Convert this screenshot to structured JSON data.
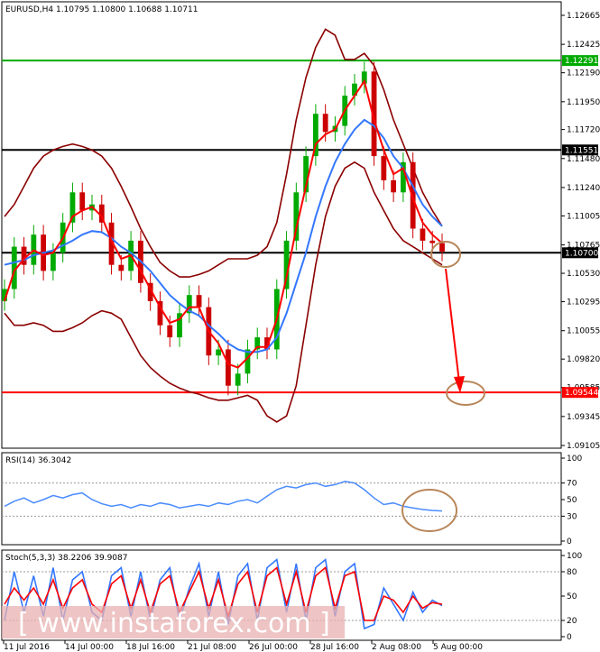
{
  "header": {
    "main": "EURUSD,H4  1.10795 1.10800 1.10688 1.10711",
    "rsi": "RSI(14) 36.3042",
    "stoch": "Stoch(5,3,3) 38.2206 39.9087"
  },
  "watermark": "[  www.instaforex.com  ]",
  "colors": {
    "bull_candle": "#00aa00",
    "bear_candle": "#cc0000",
    "ma_fast": "#ff0000",
    "ma_slow": "#3377ff",
    "bollinger": "#8b0000",
    "support_red": "#ff0000",
    "resistance_green": "#00aa00",
    "level_black": "#000000",
    "annotation": "#b8865a",
    "rsi_line": "#4a8cff",
    "stoch_main": "#3377ff",
    "stoch_signal": "#ff0000"
  },
  "chart_data": [
    {
      "type": "line",
      "name": "EURUSD H4 price",
      "y_ticks": [
        "1.12665",
        "1.12425",
        "1.12190",
        "1.11950",
        "1.11720",
        "1.11480",
        "1.11240",
        "1.11005",
        "1.10765",
        "1.10530",
        "1.10295",
        "1.10055",
        "1.09820",
        "1.09585",
        "1.09345",
        "1.09105"
      ],
      "ylim": [
        1.09105,
        1.12665
      ],
      "x_ticks": [
        "11 Jul 2016",
        "14 Jul 00:00",
        "18 Jul 16:00",
        "21 Jul 08:00",
        "26 Jul 00:00",
        "28 Jul 16:00",
        "2 Aug 08:00",
        "5 Aug 00:00"
      ],
      "levels": [
        {
          "value": 1.12291,
          "label": "1.12291",
          "color": "#00aa00"
        },
        {
          "value": 1.11551,
          "label": "1.11551",
          "color": "#000000"
        },
        {
          "value": 1.107,
          "label": "1.10700",
          "color": "#000000"
        },
        {
          "value": 1.09544,
          "label": "1.09544",
          "color": "#ff0000"
        }
      ],
      "close_series": [
        1.104,
        1.1075,
        1.106,
        1.1085,
        1.1055,
        1.107,
        1.1095,
        1.112,
        1.1105,
        1.111,
        1.1095,
        1.106,
        1.1055,
        1.108,
        1.1045,
        1.103,
        1.101,
        1.1,
        1.102,
        1.1035,
        1.1025,
        1.0985,
        1.099,
        1.096,
        1.097,
        1.099,
        1.1,
        1.099,
        1.104,
        1.108,
        1.112,
        1.115,
        1.1185,
        1.117,
        1.1175,
        1.12,
        1.121,
        1.122,
        1.115,
        1.113,
        1.112,
        1.1145,
        1.109,
        1.108,
        1.1078,
        1.1071
      ],
      "ma_fast": [
        1.103,
        1.1055,
        1.1065,
        1.1072,
        1.1068,
        1.107,
        1.1082,
        1.11,
        1.1105,
        1.1108,
        1.11,
        1.108,
        1.1065,
        1.1068,
        1.1055,
        1.104,
        1.1025,
        1.1012,
        1.1015,
        1.1025,
        1.1025,
        1.1005,
        1.0995,
        1.0978,
        1.0975,
        1.0983,
        1.0992,
        1.0992,
        1.1015,
        1.105,
        1.109,
        1.1125,
        1.116,
        1.1168,
        1.1172,
        1.1188,
        1.12,
        1.1212,
        1.118,
        1.1155,
        1.1135,
        1.114,
        1.1115,
        1.1095,
        1.1085,
        1.1078
      ],
      "ma_slow": [
        1.106,
        1.1062,
        1.1064,
        1.1068,
        1.107,
        1.1072,
        1.1076,
        1.108,
        1.1085,
        1.1088,
        1.1087,
        1.1082,
        1.1075,
        1.107,
        1.1063,
        1.1055,
        1.1045,
        1.1035,
        1.1028,
        1.1022,
        1.1018,
        1.101,
        1.1003,
        1.0995,
        1.099,
        1.0988,
        1.0988,
        1.099,
        1.1,
        1.102,
        1.1045,
        1.107,
        1.11,
        1.1125,
        1.1145,
        1.116,
        1.1172,
        1.118,
        1.1175,
        1.1165,
        1.115,
        1.114,
        1.1125,
        1.111,
        1.11,
        1.1092
      ],
      "bb_upper": [
        1.11,
        1.111,
        1.1125,
        1.114,
        1.115,
        1.1155,
        1.1158,
        1.116,
        1.1158,
        1.1155,
        1.115,
        1.114,
        1.1125,
        1.1108,
        1.109,
        1.1075,
        1.1062,
        1.1055,
        1.105,
        1.105,
        1.1052,
        1.1055,
        1.106,
        1.1065,
        1.1065,
        1.1065,
        1.1068,
        1.1075,
        1.1095,
        1.1135,
        1.118,
        1.1215,
        1.124,
        1.1255,
        1.125,
        1.123,
        1.123,
        1.1235,
        1.1225,
        1.1205,
        1.118,
        1.116,
        1.114,
        1.112,
        1.1105,
        1.1092
      ],
      "bb_lower": [
        1.102,
        1.101,
        1.101,
        1.1012,
        1.101,
        1.1005,
        1.1005,
        1.1008,
        1.1012,
        1.1018,
        1.1022,
        1.102,
        1.1015,
        1.1,
        1.0985,
        1.0975,
        1.0968,
        1.0962,
        1.0958,
        1.0955,
        1.0953,
        1.095,
        1.0948,
        1.0948,
        1.095,
        1.0952,
        1.0948,
        1.0935,
        1.093,
        1.0935,
        1.096,
        1.101,
        1.106,
        1.11,
        1.1125,
        1.114,
        1.1145,
        1.114,
        1.112,
        1.1105,
        1.109,
        1.108,
        1.1075,
        1.107,
        1.1065,
        1.106
      ]
    },
    {
      "type": "line",
      "name": "RSI(14)",
      "y_ticks": [
        "100",
        "70",
        "50",
        "30",
        "0"
      ],
      "ylim": [
        0,
        100
      ],
      "values": [
        42,
        48,
        52,
        46,
        50,
        55,
        52,
        56,
        58,
        50,
        45,
        42,
        44,
        40,
        44,
        42,
        46,
        44,
        40,
        42,
        44,
        42,
        46,
        44,
        48,
        50,
        46,
        54,
        62,
        66,
        64,
        68,
        70,
        66,
        68,
        72,
        70,
        62,
        52,
        44,
        46,
        42,
        40,
        38,
        37,
        36.3
      ]
    },
    {
      "type": "line",
      "name": "Stoch(5,3,3)",
      "y_ticks": [
        "100",
        "80",
        "50",
        "20",
        "0"
      ],
      "ylim": [
        0,
        100
      ],
      "main": [
        20,
        80,
        30,
        75,
        25,
        85,
        20,
        70,
        80,
        30,
        20,
        75,
        85,
        25,
        80,
        20,
        70,
        85,
        20,
        60,
        90,
        25,
        80,
        15,
        75,
        90,
        20,
        85,
        95,
        30,
        90,
        20,
        85,
        95,
        25,
        80,
        90,
        10,
        15,
        60,
        40,
        20,
        55,
        30,
        45,
        38.2
      ],
      "signal": [
        40,
        60,
        45,
        60,
        40,
        70,
        35,
        60,
        70,
        40,
        30,
        65,
        75,
        35,
        70,
        30,
        65,
        75,
        30,
        55,
        80,
        35,
        70,
        25,
        65,
        80,
        30,
        75,
        85,
        40,
        80,
        30,
        75,
        85,
        35,
        75,
        80,
        20,
        20,
        50,
        45,
        30,
        50,
        35,
        42,
        39.9
      ]
    }
  ]
}
